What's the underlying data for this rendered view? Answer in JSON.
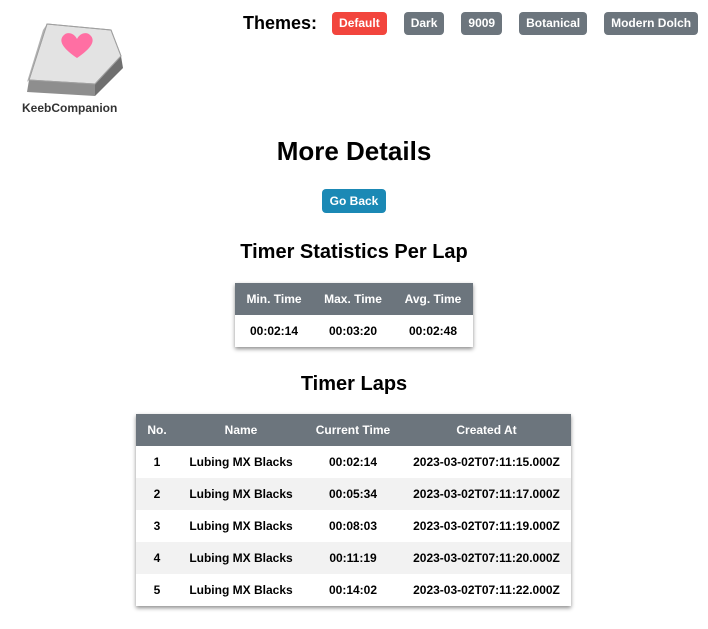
{
  "brand": {
    "name": "KeebCompanion",
    "logo_icon": "keycap-heart-icon"
  },
  "themes": {
    "label": "Themes:",
    "options": [
      {
        "label": "Default",
        "active": true
      },
      {
        "label": "Dark",
        "active": false
      },
      {
        "label": "9009",
        "active": false
      },
      {
        "label": "Botanical",
        "active": false
      },
      {
        "label": "Modern Dolch",
        "active": false
      }
    ]
  },
  "page_title": "More Details",
  "back_button": "Go Back",
  "stats_section": {
    "title": "Timer Statistics Per Lap",
    "headers": [
      "Min. Time",
      "Max. Time",
      "Avg. Time"
    ],
    "row": [
      "00:02:14",
      "00:03:20",
      "00:02:48"
    ]
  },
  "laps_section": {
    "title": "Timer Laps",
    "headers": [
      "No.",
      "Name",
      "Current Time",
      "Created At"
    ],
    "rows": [
      [
        "1",
        "Lubing MX Blacks",
        "00:02:14",
        "2023-03-02T07:11:15.000Z"
      ],
      [
        "2",
        "Lubing MX Blacks",
        "00:05:34",
        "2023-03-02T07:11:17.000Z"
      ],
      [
        "3",
        "Lubing MX Blacks",
        "00:08:03",
        "2023-03-02T07:11:19.000Z"
      ],
      [
        "4",
        "Lubing MX Blacks",
        "00:11:19",
        "2023-03-02T07:11:20.000Z"
      ],
      [
        "5",
        "Lubing MX Blacks",
        "00:14:02",
        "2023-03-02T07:11:22.000Z"
      ]
    ]
  },
  "colors": {
    "active_theme": "#f2453d",
    "theme_button": "#6c757d",
    "back_button": "#1b89b5",
    "table_header": "#6c757d",
    "heart": "#ff6fa3"
  }
}
